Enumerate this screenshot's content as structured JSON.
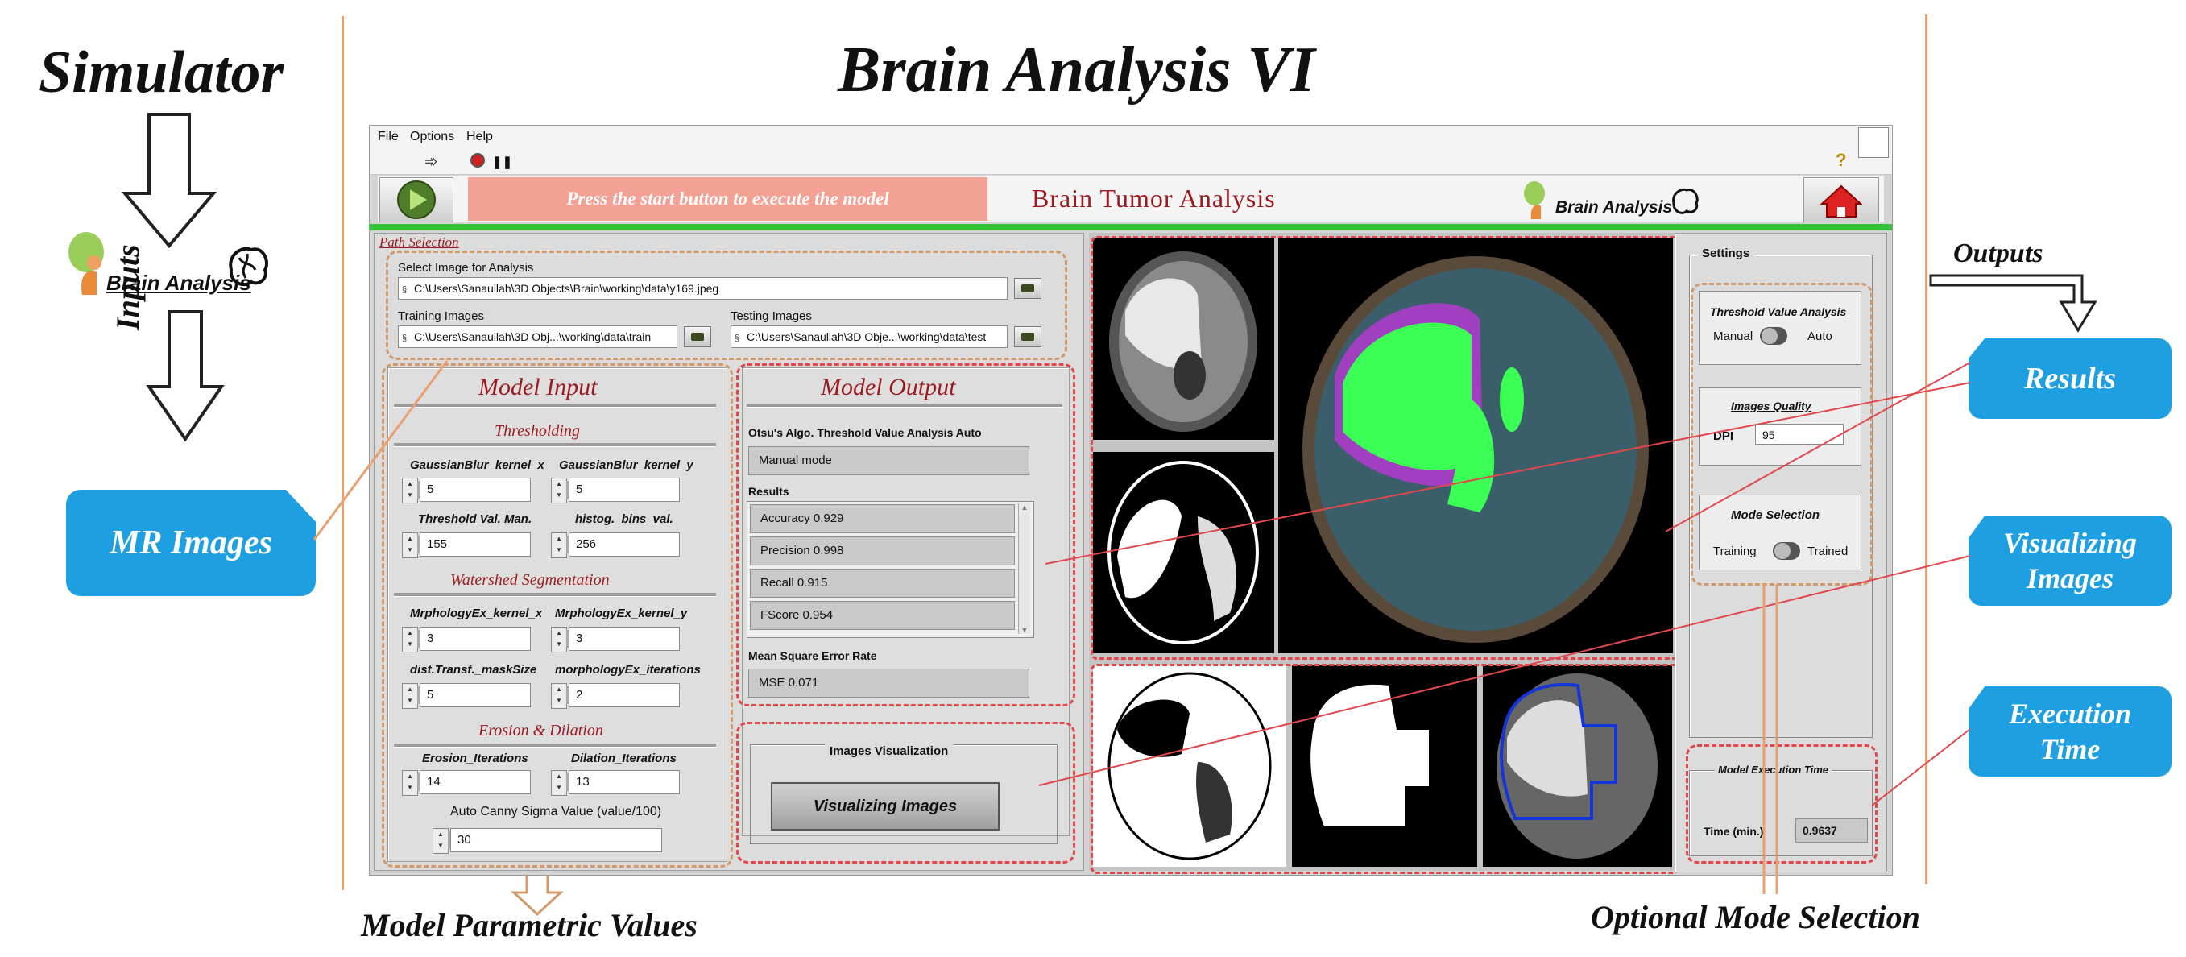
{
  "outer": {
    "simulator_title": "Simulator",
    "main_title": "Brain Analysis VI",
    "logo_text": "Brain Analysis",
    "inputs_label": "Inputs",
    "outputs_label": "Outputs",
    "mr_images_tag": "MR Images",
    "results_tag": "Results",
    "visualizing_tag_line1": "Visualizing",
    "visualizing_tag_line2": "Images",
    "execution_tag_line1": "Execution",
    "execution_tag_line2": "Time",
    "model_parametric_caption": "Model Parametric Values",
    "optional_mode_caption": "Optional Mode Selection"
  },
  "app": {
    "menu": [
      "File",
      "Options",
      "Help"
    ],
    "help_glyph": "?",
    "start_hint": "Press the start button to execute the model",
    "app_title": "Brain Tumor Analysis",
    "header_logo_text": "Brain Analysis"
  },
  "path_selection": {
    "section_title": "Path Selection",
    "select_label": "Select Image for Analysis",
    "select_value": "C:\\Users\\Sanaullah\\3D Objects\\Brain\\working\\data\\y169.jpeg",
    "training_label": "Training Images",
    "training_value": "C:\\Users\\Sanaullah\\3D Obj...\\working\\data\\train",
    "testing_label": "Testing Images",
    "testing_value": "C:\\Users\\Sanaullah\\3D Obje...\\working\\data\\test"
  },
  "model_input": {
    "title": "Model Input",
    "thresholding_title": "Thresholding",
    "gb_x_label": "GaussianBlur_kernel_x",
    "gb_x_value": "5",
    "gb_y_label": "GaussianBlur_kernel_y",
    "gb_y_value": "5",
    "thr_label": "Threshold Val. Man.",
    "thr_value": "155",
    "hist_label": "histog._bins_val.",
    "hist_value": "256",
    "watershed_title": "Watershed Segmentation",
    "mx_label": "MrphologyEx_kernel_x",
    "mx_value": "3",
    "my_label": "MrphologyEx_kernel_y",
    "my_value": "3",
    "dist_label": "dist.Transf._maskSize",
    "dist_value": "5",
    "morph_it_label": "morphologyEx_iterations",
    "morph_it_value": "2",
    "erosion_title": "Erosion & Dilation",
    "ero_label": "Erosion_Iterations",
    "ero_value": "14",
    "dil_label": "Dilation_Iterations",
    "dil_value": "13",
    "canny_label": "Auto Canny Sigma Value (value/100)",
    "canny_value": "30"
  },
  "model_output": {
    "title": "Model Output",
    "otsu_label": "Otsu's Algo. Threshold Value Analysis Auto",
    "otsu_value": "Manual mode",
    "results_label": "Results",
    "results": [
      "Accuracy 0.929",
      "Precision 0.998",
      "Recall 0.915",
      "FScore 0.954"
    ],
    "mse_label": "Mean Square Error Rate",
    "mse_value": "MSE 0.071"
  },
  "visualization": {
    "group_label": "Images Visualization",
    "button_label": "Visualizing Images"
  },
  "settings": {
    "title": "Settings",
    "thr_group": "Threshold Value Analysis",
    "thr_left": "Manual",
    "thr_right": "Auto",
    "quality_group": "Images Quality",
    "dpi_label": "DPI",
    "dpi_value": "95",
    "mode_group": "Mode Selection",
    "mode_left": "Training",
    "mode_right": "Trained",
    "exec_group": "Model Execution Time",
    "time_label": "Time (min.)",
    "time_value": "0.9637"
  },
  "colors": {
    "accent_red": "#9b1a1f",
    "start_banner": "#f2a194",
    "blue_tag": "#1e9fe1",
    "green_strip": "#35c23b",
    "dash_red": "#e0484c",
    "dash_orange": "#d29a6a"
  }
}
